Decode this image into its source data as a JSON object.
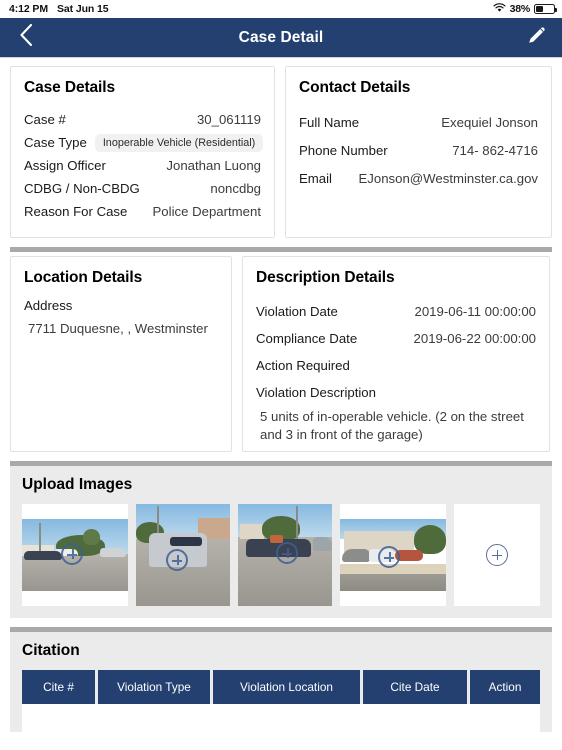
{
  "status_bar": {
    "time": "4:12 PM",
    "date": "Sat Jun 15",
    "wifi_icon": "wifi-icon",
    "battery_percent": "38%",
    "battery_icon": "battery-icon"
  },
  "nav": {
    "back_icon": "chevron-left-icon",
    "title": "Case Detail",
    "edit_icon": "pencil-icon"
  },
  "case_details": {
    "heading": "Case Details",
    "rows": [
      {
        "label": "Case #",
        "value": "30_061119",
        "style": "plain"
      },
      {
        "label": "Case Type",
        "value": "Inoperable Vehicle (Residential)",
        "style": "pill"
      },
      {
        "label": "Assign Officer",
        "value": "Jonathan  Luong",
        "style": "plain"
      },
      {
        "label": "CDBG / Non-CBDG",
        "value": "noncdbg",
        "style": "plain"
      },
      {
        "label": "Reason For Case",
        "value": "Police Department",
        "style": "plain"
      }
    ]
  },
  "contact_details": {
    "heading": "Contact Details",
    "rows": [
      {
        "label": "Full Name",
        "value": "Exequiel  Jonson"
      },
      {
        "label": "Phone Number",
        "value": "714- 862-4716"
      },
      {
        "label": "Email",
        "value": "EJonson@Westminster.ca.gov"
      }
    ]
  },
  "location_details": {
    "heading": "Location Details",
    "address_label": "Address",
    "address_value": "7711 Duquesne, , Westminster"
  },
  "description_details": {
    "heading": "Description Details",
    "rows": [
      {
        "label": "Violation Date",
        "value": "2019-06-11 00:00:00"
      },
      {
        "label": "Compliance Date",
        "value": "2019-06-22 00:00:00"
      }
    ],
    "action_required_label": "Action Required",
    "action_required_value": "",
    "violation_description_label": "Violation Description",
    "violation_description_value": "5 units of in-operable vehicle. (2 on the street and 3 in front of the garage)"
  },
  "upload_images": {
    "heading": "Upload Images",
    "thumbnails": [
      {
        "alt": "street with parked cars and driveway",
        "overlay_icon": "plus-circle-icon"
      },
      {
        "alt": "silver van parked on street",
        "overlay_icon": "plus-circle-icon"
      },
      {
        "alt": "dark car parked at curb",
        "overlay_icon": "plus-circle-icon"
      },
      {
        "alt": "covered car and cars in driveway",
        "overlay_icon": "plus-circle-icon"
      }
    ],
    "add_button_icon": "plus-circle-icon"
  },
  "citation": {
    "heading": "Citation",
    "columns": [
      "Cite #",
      "Violation Type",
      "Violation Location",
      "Cite Date",
      "Action"
    ],
    "rows": []
  },
  "colors": {
    "nav_blue": "#234070",
    "table_header_blue": "#234070",
    "section_gray": "#ebebeb",
    "separator_gray": "#a9a9a9",
    "accent_plus": "#5b6e93"
  }
}
